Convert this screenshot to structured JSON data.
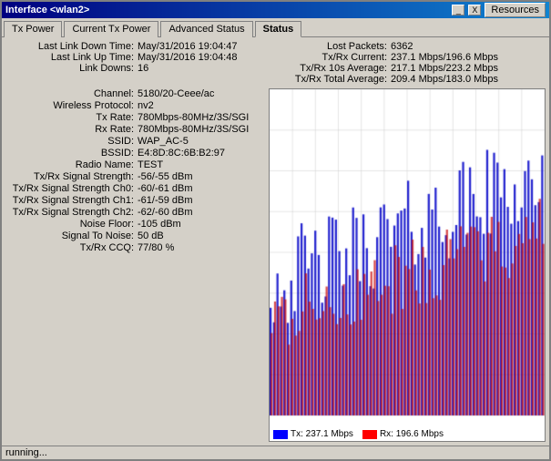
{
  "window": {
    "title": "Interface <wlan2>",
    "close_label": "X",
    "resources_label": "Resources"
  },
  "tabs": [
    {
      "label": "Tx Power",
      "active": false
    },
    {
      "label": "Current Tx Power",
      "active": false
    },
    {
      "label": "Advanced Status",
      "active": false
    },
    {
      "label": "Status",
      "active": true
    }
  ],
  "top_info": {
    "lost_packets_label": "Lost Packets:",
    "lost_packets_value": "6362",
    "tx_rx_current_label": "Tx/Rx Current:",
    "tx_rx_current_value": "237.1 Mbps/196.6 Mbps",
    "tx_rx_10s_label": "Tx/Rx 10s Average:",
    "tx_rx_10s_value": "217.1 Mbps/223.2 Mbps",
    "tx_rx_total_label": "Tx/Rx Total Average:",
    "tx_rx_total_value": "209.4 Mbps/183.0 Mbps"
  },
  "link_info": {
    "last_link_down_label": "Last Link Down Time:",
    "last_link_down_value": "May/31/2016 19:04:47",
    "last_link_up_label": "Last Link Up Time:",
    "last_link_up_value": "May/31/2016 19:04:48",
    "link_downs_label": "Link Downs:",
    "link_downs_value": "16"
  },
  "radio_info": {
    "channel_label": "Channel:",
    "channel_value": "5180/20-Ceee/ac",
    "wireless_protocol_label": "Wireless Protocol:",
    "wireless_protocol_value": "nv2",
    "tx_rate_label": "Tx Rate:",
    "tx_rate_value": "780Mbps-80MHz/3S/SGI",
    "rx_rate_label": "Rx Rate:",
    "rx_rate_value": "780Mbps-80MHz/3S/SGI",
    "ssid_label": "SSID:",
    "ssid_value": "WAP_AC-5",
    "bssid_label": "BSSID:",
    "bssid_value": "E4:8D:8C:6B:B2:97",
    "radio_name_label": "Radio Name:",
    "radio_name_value": "TEST",
    "tx_rx_signal_label": "Tx/Rx Signal Strength:",
    "tx_rx_signal_value": "-56/-55 dBm",
    "tx_rx_signal_ch0_label": "Tx/Rx Signal Strength Ch0:",
    "tx_rx_signal_ch0_value": "-60/-61 dBm",
    "tx_rx_signal_ch1_label": "Tx/Rx Signal Strength Ch1:",
    "tx_rx_signal_ch1_value": "-61/-59 dBm",
    "tx_rx_signal_ch2_label": "Tx/Rx Signal Strength Ch2:",
    "tx_rx_signal_ch2_value": "-62/-60 dBm",
    "noise_floor_label": "Noise Floor:",
    "noise_floor_value": "-105 dBm",
    "signal_to_noise_label": "Signal To Noise:",
    "signal_to_noise_value": "50 dB",
    "tx_rx_ccq_label": "Tx/Rx CCQ:",
    "tx_rx_ccq_value": "77/80 %"
  },
  "chart": {
    "tx_label": "Tx:",
    "tx_value": "237.1 Mbps",
    "rx_label": "Rx:",
    "rx_value": "196.6 Mbps",
    "tx_color": "#0000ff",
    "rx_color": "#ff0000"
  },
  "status_bar": {
    "text": "running..."
  }
}
